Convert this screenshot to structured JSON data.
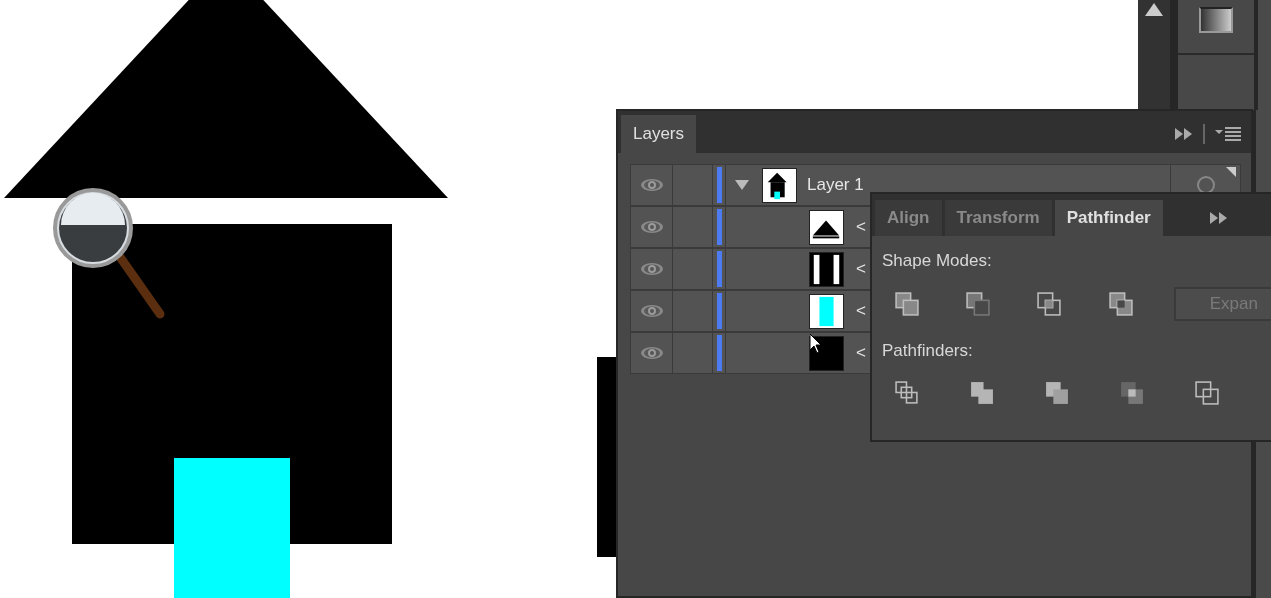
{
  "layers_panel": {
    "tabs": [
      {
        "label": "Layers",
        "selected": true
      }
    ],
    "layers": [
      {
        "name": "Layer 1",
        "visible": true,
        "expanded": true,
        "children": [
          {
            "name": "<",
            "visible": true,
            "kind": "triangle"
          },
          {
            "name": "<",
            "visible": true,
            "kind": "bars"
          },
          {
            "name": "<",
            "visible": true,
            "kind": "cyan"
          },
          {
            "name": "<",
            "visible": true,
            "kind": "black"
          }
        ]
      }
    ]
  },
  "pathfinder_panel": {
    "tabs": [
      {
        "label": "Align",
        "selected": false
      },
      {
        "label": "Transform",
        "selected": false
      },
      {
        "label": "Pathfinder",
        "selected": true
      }
    ],
    "sections": [
      {
        "label": "Shape Modes:",
        "buttons": [
          {
            "kind": "unite"
          },
          {
            "kind": "minus-front"
          },
          {
            "kind": "intersect"
          },
          {
            "kind": "exclude"
          }
        ]
      },
      {
        "label": "Pathfinders:",
        "buttons": [
          {
            "kind": "divide"
          },
          {
            "kind": "trim"
          },
          {
            "kind": "merge"
          },
          {
            "kind": "crop"
          },
          {
            "kind": "outline"
          }
        ]
      }
    ],
    "expand_button": {
      "label": "Expan",
      "disabled": true
    }
  }
}
